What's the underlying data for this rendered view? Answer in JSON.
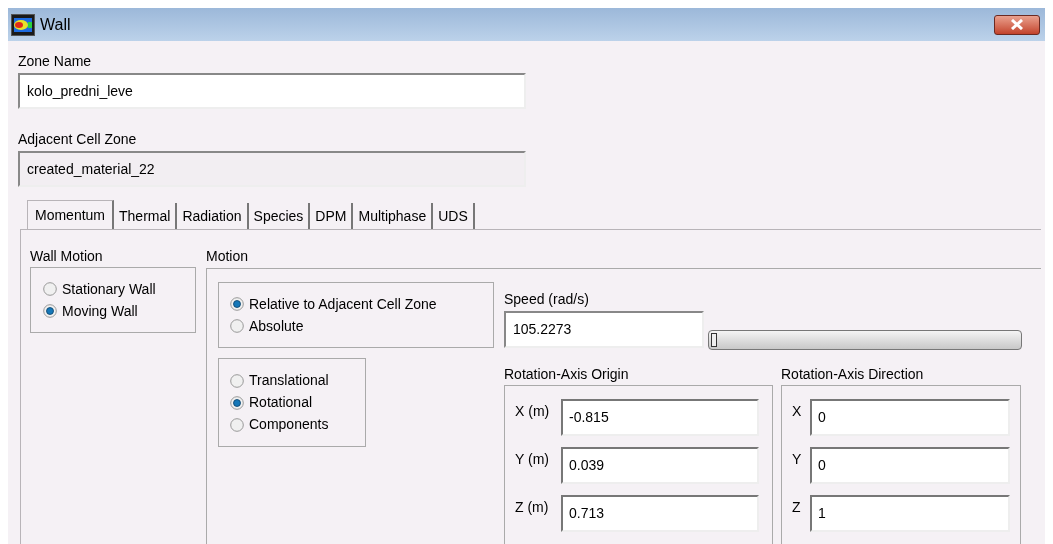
{
  "window": {
    "title": "Wall"
  },
  "zone_name": {
    "label": "Zone Name",
    "value": "kolo_predni_leve"
  },
  "adjacent_cell_zone": {
    "label": "Adjacent Cell Zone",
    "value": "created_material_22"
  },
  "tabs": [
    {
      "label": "Momentum",
      "selected": true
    },
    {
      "label": "Thermal",
      "selected": false
    },
    {
      "label": "Radiation",
      "selected": false
    },
    {
      "label": "Species",
      "selected": false
    },
    {
      "label": "DPM",
      "selected": false
    },
    {
      "label": "Multiphase",
      "selected": false
    },
    {
      "label": "UDS",
      "selected": false
    }
  ],
  "wall_motion": {
    "label": "Wall Motion",
    "options": [
      {
        "label": "Stationary Wall",
        "selected": false
      },
      {
        "label": "Moving Wall",
        "selected": true
      }
    ]
  },
  "motion": {
    "label": "Motion",
    "reference": [
      {
        "label": "Relative to Adjacent Cell Zone",
        "selected": true
      },
      {
        "label": "Absolute",
        "selected": false
      }
    ],
    "type": [
      {
        "label": "Translational",
        "selected": false
      },
      {
        "label": "Rotational",
        "selected": true
      },
      {
        "label": "Components",
        "selected": false
      }
    ],
    "speed": {
      "label": "Speed (rad/s)",
      "value": "105.2273",
      "level": 0
    },
    "origin": {
      "label": "Rotation-Axis Origin",
      "fields": [
        {
          "label": "X (m)",
          "value": "-0.815"
        },
        {
          "label": "Y (m)",
          "value": "0.039"
        },
        {
          "label": "Z (m)",
          "value": "0.713"
        }
      ]
    },
    "direction": {
      "label": "Rotation-Axis Direction",
      "fields": [
        {
          "label": "X",
          "value": "0"
        },
        {
          "label": "Y",
          "value": "0"
        },
        {
          "label": "Z",
          "value": "1"
        }
      ]
    }
  }
}
